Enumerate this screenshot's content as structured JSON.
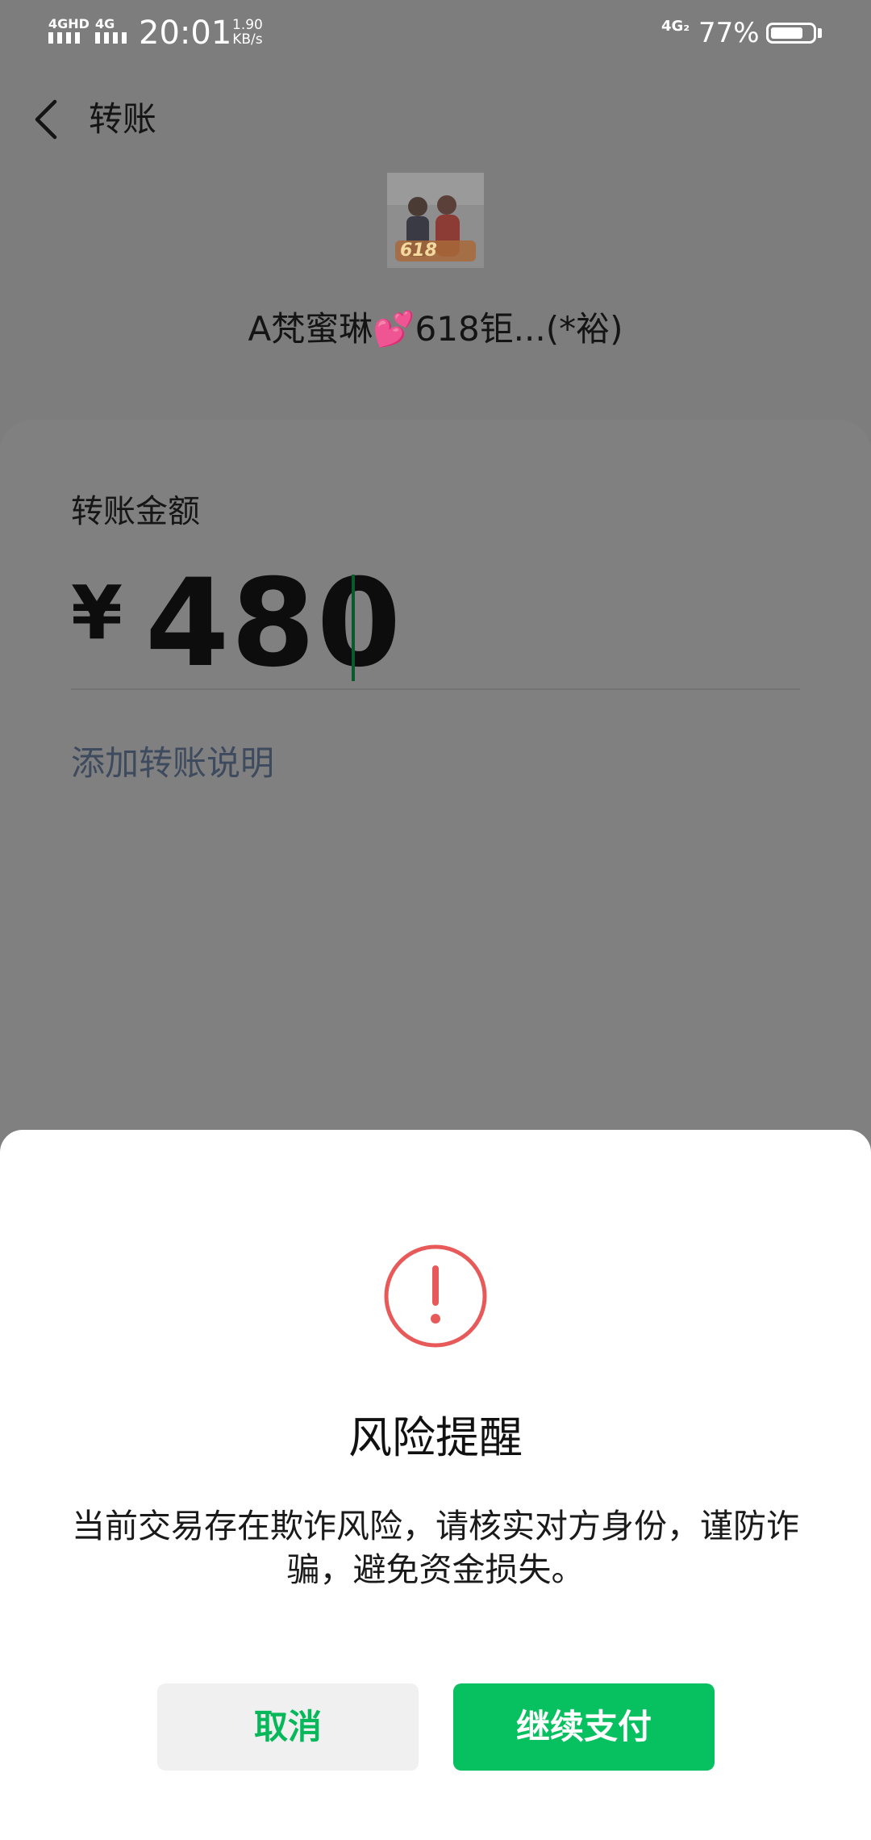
{
  "status_bar": {
    "signal_1_label": "4GHD",
    "signal_2_label": "4G",
    "time": "20:01",
    "net_speed_value": "1.90",
    "net_speed_unit": "KB/s",
    "network_label": "4G₂",
    "battery_percent_text": "77%",
    "battery_level": 0.77
  },
  "header": {
    "back_icon": "chevron-left-icon",
    "title": "转账"
  },
  "payee": {
    "avatar_text": "618",
    "name": "A梵蜜琳💕618钜...(*裕)"
  },
  "amount_section": {
    "label": "转账金额",
    "currency_symbol": "¥",
    "amount": "480",
    "add_note_link": "添加转账说明"
  },
  "risk_dialog": {
    "icon": "exclamation-circle-icon",
    "title": "风险提醒",
    "message": "当前交易存在欺诈风险，请核实对方身份，谨防诈骗，避免资金损失。",
    "cancel_label": "取消",
    "continue_label": "继续支付"
  },
  "colors": {
    "accent_green": "#07c160",
    "warning_red": "#e85a5a",
    "overlay_gray": "#7d7d7d"
  }
}
